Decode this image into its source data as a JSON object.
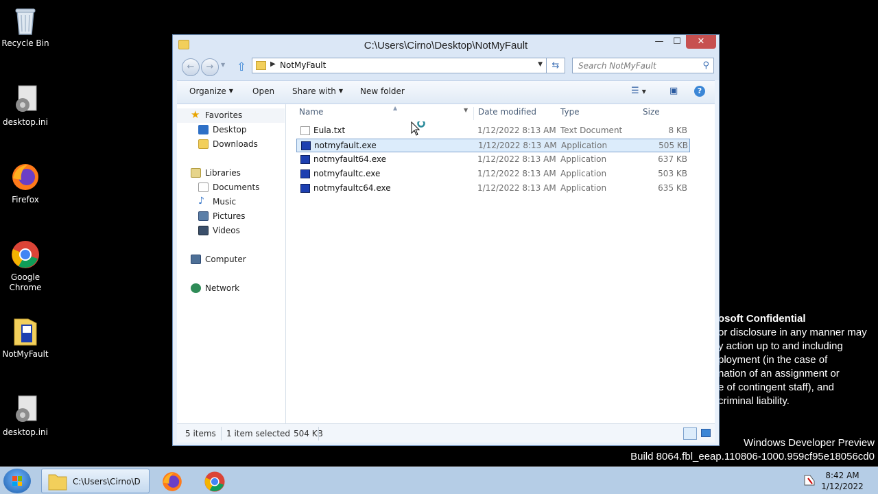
{
  "desktop": {
    "icons": [
      {
        "label": "Recycle Bin"
      },
      {
        "label": "desktop.ini"
      },
      {
        "label": "Firefox"
      },
      {
        "label": "Google Chrome"
      },
      {
        "label": "NotMyFault"
      },
      {
        "label": "desktop.ini"
      }
    ],
    "watermark_lines": [
      "osoft Confidential",
      "or disclosure in any manner may",
      "y action up to and including",
      "ployment (in the case of",
      "nation of an assignment or",
      "e of contingent staff), and",
      "criminal liability."
    ],
    "build_line1": "Windows Developer Preview",
    "build_line2": "Build 8064.fbl_eeap.110806-1000.959cf95e18056cd0"
  },
  "window": {
    "title": "C:\\Users\\Cirno\\Desktop\\NotMyFault",
    "controls": {
      "minimize": "—",
      "maximize": "☐",
      "close": "✕"
    },
    "address": "NotMyFault",
    "search_placeholder": "Search NotMyFault"
  },
  "toolbar": {
    "organize": "Organize",
    "open": "Open",
    "share_with": "Share with",
    "new_folder": "New folder"
  },
  "navpane": {
    "favorites": "Favorites",
    "desktop": "Desktop",
    "downloads": "Downloads",
    "libraries": "Libraries",
    "documents": "Documents",
    "music": "Music",
    "pictures": "Pictures",
    "videos": "Videos",
    "computer": "Computer",
    "network": "Network"
  },
  "columns": {
    "name": "Name",
    "date": "Date modified",
    "type": "Type",
    "size": "Size"
  },
  "files": [
    {
      "name": "Eula.txt",
      "date": "1/12/2022 8:13 AM",
      "type": "Text Document",
      "size": "8 KB",
      "icon": "text-file-icon"
    },
    {
      "name": "notmyfault.exe",
      "date": "1/12/2022 8:13 AM",
      "type": "Application",
      "size": "505 KB",
      "icon": "application-icon",
      "selected": true
    },
    {
      "name": "notmyfault64.exe",
      "date": "1/12/2022 8:13 AM",
      "type": "Application",
      "size": "637 KB",
      "icon": "application-icon"
    },
    {
      "name": "notmyfaultc.exe",
      "date": "1/12/2022 8:13 AM",
      "type": "Application",
      "size": "503 KB",
      "icon": "application-icon"
    },
    {
      "name": "notmyfaultc64.exe",
      "date": "1/12/2022 8:13 AM",
      "type": "Application",
      "size": "635 KB",
      "icon": "application-icon"
    }
  ],
  "status": {
    "item_count": "5 items",
    "selection": "1 item selected",
    "selection_size": "504 KB"
  },
  "taskbar": {
    "explorer_label": "C:\\Users\\Cirno\\D...",
    "time": "8:42 AM",
    "date": "1/12/2022"
  }
}
